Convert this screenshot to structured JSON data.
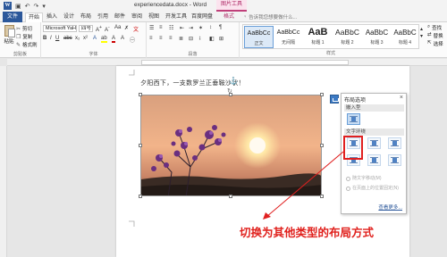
{
  "titlebar": {
    "doc_title": "experiencedata.docx - Word",
    "context_tab_group": "图片工具"
  },
  "tabs": [
    {
      "label": "文件"
    },
    {
      "label": "开始"
    },
    {
      "label": "插入"
    },
    {
      "label": "设计"
    },
    {
      "label": "布局"
    },
    {
      "label": "引用"
    },
    {
      "label": "邮件"
    },
    {
      "label": "审阅"
    },
    {
      "label": "视图"
    },
    {
      "label": "开发工具"
    },
    {
      "label": "百度网盘"
    },
    {
      "label": "格式"
    }
  ],
  "tell_me": "告诉我您想要做什么...",
  "ribbon": {
    "clipboard": {
      "paste": "粘贴",
      "cut": "剪切",
      "copy": "复制",
      "format_painter": "格式刷",
      "group_label": "剪贴板"
    },
    "font": {
      "font_name": "Microsoft YaHe",
      "font_size": "四号",
      "group_label": "字体"
    },
    "paragraph": {
      "group_label": "段落"
    },
    "styles": {
      "items": [
        {
          "sample": "AaBbCc",
          "name": "正文"
        },
        {
          "sample": "AaBbCc",
          "name": "无间隔"
        },
        {
          "sample": "AaB",
          "name": "标题 1"
        },
        {
          "sample": "AaBbC",
          "name": "标题 2"
        },
        {
          "sample": "AaBbC",
          "name": "标题 3"
        },
        {
          "sample": "AaBbC",
          "name": "标题 4"
        }
      ],
      "group_label": "样式"
    },
    "editing": {
      "find": "查找",
      "replace": "替换",
      "select": "选择"
    }
  },
  "document": {
    "text": "夕阳西下，一支数罗兰正垂鞍沙状！"
  },
  "layout_panel": {
    "title": "布局选项",
    "close": "×",
    "section_inline": "嵌入型",
    "section_wrap": "文字环绕",
    "option_move": "随文字移动(M)",
    "option_fixed": "在页面上的位置固定(N)",
    "see_more": "查看更多..."
  },
  "annotation": "切换为其他类型的布局方式",
  "colors": {
    "word_blue": "#2b579a",
    "context_pink": "#b0306b",
    "highlight_red": "#e02020"
  }
}
